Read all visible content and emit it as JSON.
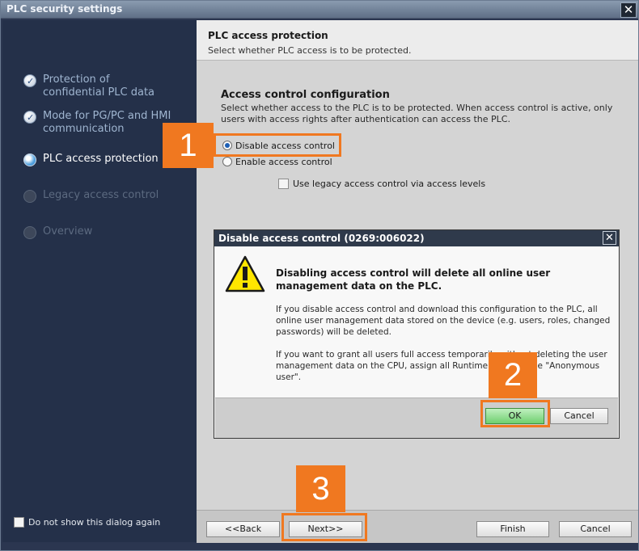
{
  "window": {
    "title": "PLC security settings",
    "close_glyph": "✕"
  },
  "sidebar": {
    "steps": [
      {
        "label": "Protection of confidential PLC data",
        "status": "done"
      },
      {
        "label": "Mode for PG/PC and HMI communication",
        "status": "done"
      },
      {
        "label": "PLC access protection",
        "status": "active"
      },
      {
        "label": "Legacy access control",
        "status": "pending"
      },
      {
        "label": "Overview",
        "status": "pending"
      }
    ],
    "dont_show_label": "Do not show this dialog again"
  },
  "content": {
    "title": "PLC access protection",
    "subtitle": "Select whether PLC access is to be protected.",
    "section_title": "Access control configuration",
    "section_desc": "Select whether access to the PLC is to be protected. When access control is active, only users with access rights after authentication can access the PLC.",
    "radio_disable": "Disable access control",
    "radio_enable": "Enable access control",
    "checkbox_legacy": "Use legacy access control via access levels"
  },
  "footer": {
    "back": "<<Back",
    "next": "Next>>",
    "finish": "Finish",
    "cancel": "Cancel"
  },
  "dialog": {
    "title": "Disable access control (0269:006022)",
    "close_glyph": "✕",
    "heading": "Disabling access control will delete all online user management data on the PLC.",
    "p1": "If you disable access control and download this configuration to the PLC, all online user management data stored on the device (e.g. users, roles, changed passwords) will be deleted.",
    "p2": "If you want to grant all users full access temporarily without deleting the user management data on the CPU, assign all Runtime rights to the \"Anonymous user\".",
    "ok": "OK",
    "cancel": "Cancel"
  },
  "callouts": [
    "1",
    "2",
    "3"
  ],
  "colors": {
    "accent_orange": "#f07820",
    "sidebar_bg": "#243049",
    "ok_green": "#7fd07f"
  }
}
